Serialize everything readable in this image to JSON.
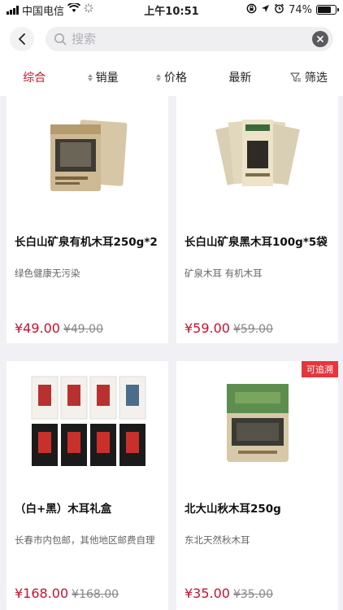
{
  "status_bar": {
    "carrier": "中国电信",
    "time": "上午10:51",
    "battery": "74%",
    "battery_level": 0.74
  },
  "search": {
    "placeholder": "搜索",
    "value": ""
  },
  "sort_tabs": [
    {
      "label": "综合",
      "active": true
    },
    {
      "label": "销量",
      "active": false
    },
    {
      "label": "价格",
      "active": false
    },
    {
      "label": "最新",
      "active": false
    },
    {
      "label": "筛选",
      "active": false
    }
  ],
  "products": [
    {
      "name": "长白山矿泉有机木耳250g*2",
      "desc": "绿色健康无污染",
      "price": "¥49.00",
      "original_price": "¥49.00",
      "badge": ""
    },
    {
      "name": "长白山矿泉黑木耳100g*5袋",
      "desc": "矿泉木耳  有机木耳",
      "price": "¥59.00",
      "original_price": "¥59.00",
      "badge": ""
    },
    {
      "name": "（白+黑）木耳礼盒",
      "desc": "长春市内包邮，其他地区邮费自理",
      "price": "¥168.00",
      "original_price": "¥168.00",
      "badge": ""
    },
    {
      "name": "北大山秋木耳250g",
      "desc": "东北天然秋木耳",
      "price": "¥35.00",
      "original_price": "¥35.00",
      "badge": "可追溯"
    }
  ],
  "colors": {
    "accent": "#c8102e",
    "badge": "#e5363c",
    "background": "#f1f1f5"
  }
}
